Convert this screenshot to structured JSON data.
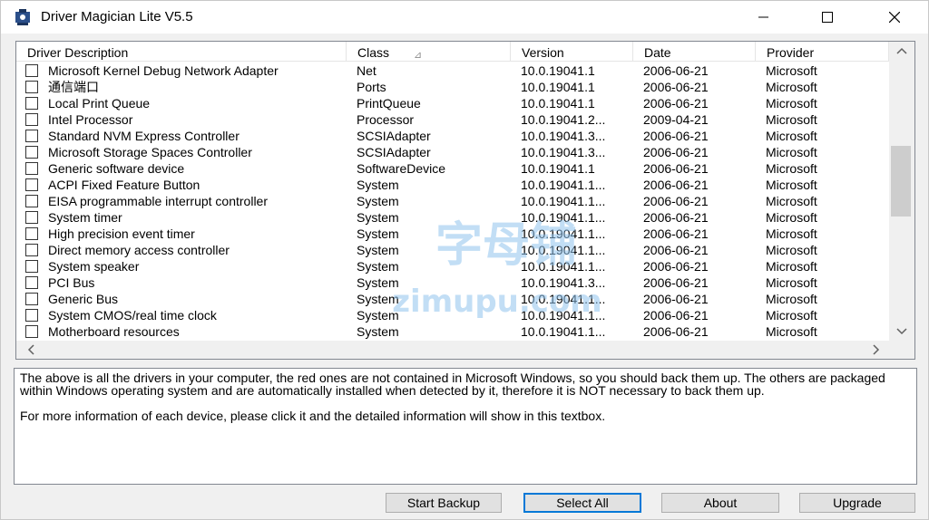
{
  "window": {
    "title": "Driver Magician Lite V5.5",
    "controls": {
      "minimize": "minimize-icon",
      "maximize": "maximize-icon",
      "close": "close-icon"
    }
  },
  "table": {
    "columns": [
      "Driver Description",
      "Class",
      "Version",
      "Date",
      "Provider"
    ],
    "sorted_column": "Class",
    "rows": [
      {
        "description": "Microsoft Kernel Debug Network Adapter",
        "class": "Net",
        "version": "10.0.19041.1",
        "date": "2006-06-21",
        "provider": "Microsoft"
      },
      {
        "description": "通信端口",
        "class": "Ports",
        "version": "10.0.19041.1",
        "date": "2006-06-21",
        "provider": "Microsoft"
      },
      {
        "description": "Local Print Queue",
        "class": "PrintQueue",
        "version": "10.0.19041.1",
        "date": "2006-06-21",
        "provider": "Microsoft"
      },
      {
        "description": "Intel Processor",
        "class": "Processor",
        "version": "10.0.19041.2...",
        "date": "2009-04-21",
        "provider": "Microsoft"
      },
      {
        "description": "Standard NVM Express Controller",
        "class": "SCSIAdapter",
        "version": "10.0.19041.3...",
        "date": "2006-06-21",
        "provider": "Microsoft"
      },
      {
        "description": "Microsoft Storage Spaces Controller",
        "class": "SCSIAdapter",
        "version": "10.0.19041.3...",
        "date": "2006-06-21",
        "provider": "Microsoft"
      },
      {
        "description": "Generic software device",
        "class": "SoftwareDevice",
        "version": "10.0.19041.1",
        "date": "2006-06-21",
        "provider": "Microsoft"
      },
      {
        "description": "ACPI Fixed Feature Button",
        "class": "System",
        "version": "10.0.19041.1...",
        "date": "2006-06-21",
        "provider": "Microsoft"
      },
      {
        "description": "EISA programmable interrupt controller",
        "class": "System",
        "version": "10.0.19041.1...",
        "date": "2006-06-21",
        "provider": "Microsoft"
      },
      {
        "description": "System timer",
        "class": "System",
        "version": "10.0.19041.1...",
        "date": "2006-06-21",
        "provider": "Microsoft"
      },
      {
        "description": "High precision event timer",
        "class": "System",
        "version": "10.0.19041.1...",
        "date": "2006-06-21",
        "provider": "Microsoft"
      },
      {
        "description": "Direct memory access controller",
        "class": "System",
        "version": "10.0.19041.1...",
        "date": "2006-06-21",
        "provider": "Microsoft"
      },
      {
        "description": "System speaker",
        "class": "System",
        "version": "10.0.19041.1...",
        "date": "2006-06-21",
        "provider": "Microsoft"
      },
      {
        "description": "PCI Bus",
        "class": "System",
        "version": "10.0.19041.3...",
        "date": "2006-06-21",
        "provider": "Microsoft"
      },
      {
        "description": "Generic Bus",
        "class": "System",
        "version": "10.0.19041.1...",
        "date": "2006-06-21",
        "provider": "Microsoft"
      },
      {
        "description": "System CMOS/real time clock",
        "class": "System",
        "version": "10.0.19041.1...",
        "date": "2006-06-21",
        "provider": "Microsoft"
      },
      {
        "description": "Motherboard resources",
        "class": "System",
        "version": "10.0.19041.1...",
        "date": "2006-06-21",
        "provider": "Microsoft"
      }
    ]
  },
  "info": {
    "paragraph1": "The above is all the drivers in your computer, the red ones are not contained in Microsoft Windows, so you should back them up. The others are packaged within Windows operating system and are automatically installed when detected by it, therefore it is NOT necessary to back them up.",
    "paragraph2": "For more information of each device, please click it and the detailed information will show in this textbox."
  },
  "buttons": {
    "start_backup": "Start Backup",
    "select_all": "Select All",
    "about": "About",
    "upgrade": "Upgrade"
  },
  "watermark": {
    "text_cn": "字母铺",
    "text_en": "zimupu.com",
    "color": "#8fc3ec"
  },
  "colors": {
    "focus_border": "#0078d7",
    "button_face": "#e1e1e1",
    "thumb": "#cdcdcd"
  }
}
